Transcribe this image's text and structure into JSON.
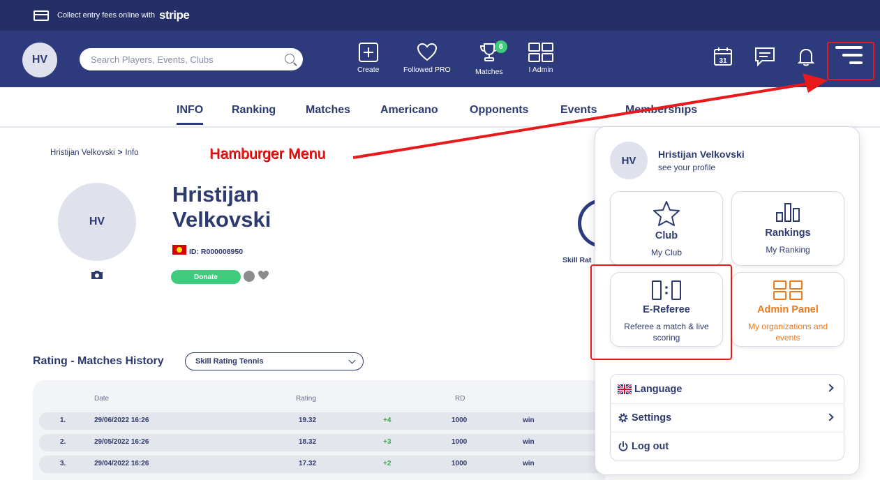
{
  "stripe_banner": {
    "text": "Collect entry fees online with",
    "brand": "stripe"
  },
  "header": {
    "avatar_initials": "HV",
    "search_placeholder": "Search Players, Events, Clubs",
    "nav": [
      {
        "label": "Create",
        "icon": "plus-square-icon"
      },
      {
        "label": "Followed PRO",
        "icon": "heart-icon"
      },
      {
        "label": "Matches",
        "icon": "trophy-icon",
        "badge": "6"
      },
      {
        "label": "I Admin",
        "icon": "grid-icon"
      }
    ],
    "calendar_day": "31"
  },
  "tabs": [
    "INFO",
    "Ranking",
    "Matches",
    "Americano",
    "Opponents",
    "Events",
    "Memberships"
  ],
  "breadcrumb": {
    "name": "Hristijan Velkovski",
    "sep": ">",
    "current": "Info"
  },
  "annotation": "Hamburger Menu",
  "profile": {
    "initials": "HV",
    "name": "Hristijan Velkovski",
    "id": "ID: R000008950",
    "donate_label": "Donate",
    "skill_label": "Skill Rat"
  },
  "history": {
    "title": "Rating - Matches History",
    "select_value": "Skill Rating Tennis",
    "headers": {
      "date": "Date",
      "rating": "Rating",
      "rd": "RD"
    },
    "rows": [
      {
        "idx": "1.",
        "date": "29/06/2022 16:26",
        "rating": "19.32",
        "delta": "+4",
        "rd": "1000",
        "result": "win"
      },
      {
        "idx": "2.",
        "date": "29/05/2022 16:26",
        "rating": "18.32",
        "delta": "+3",
        "rd": "1000",
        "result": "win"
      },
      {
        "idx": "3.",
        "date": "29/04/2022 16:26",
        "rating": "17.32",
        "delta": "+2",
        "rd": "1000",
        "result": "win"
      }
    ]
  },
  "menu": {
    "user": {
      "initials": "HV",
      "name": "Hristijan Velkovski",
      "sub": "see your profile"
    },
    "cards": [
      {
        "title": "Club",
        "sub": "My Club",
        "icon": "star-icon"
      },
      {
        "title": "Rankings",
        "sub": "My Ranking",
        "icon": "bar-chart-icon"
      },
      {
        "title": "E-Referee",
        "sub": "Referee a match & live scoring",
        "icon": "scoreboard-icon"
      },
      {
        "title": "Admin Panel",
        "sub": "My organizations and events",
        "icon": "grid-icon",
        "color": "#ec7a1c"
      }
    ],
    "list": [
      {
        "label": "Language",
        "icon": "uk-flag-icon"
      },
      {
        "label": "Settings",
        "icon": "gear-icon"
      },
      {
        "label": "Log out",
        "icon": "power-icon"
      }
    ]
  },
  "colors": {
    "navy": "#2d3a7c",
    "green": "#3ecb7c",
    "orange": "#ec7a1c",
    "annotation_red": "#e8191a"
  }
}
